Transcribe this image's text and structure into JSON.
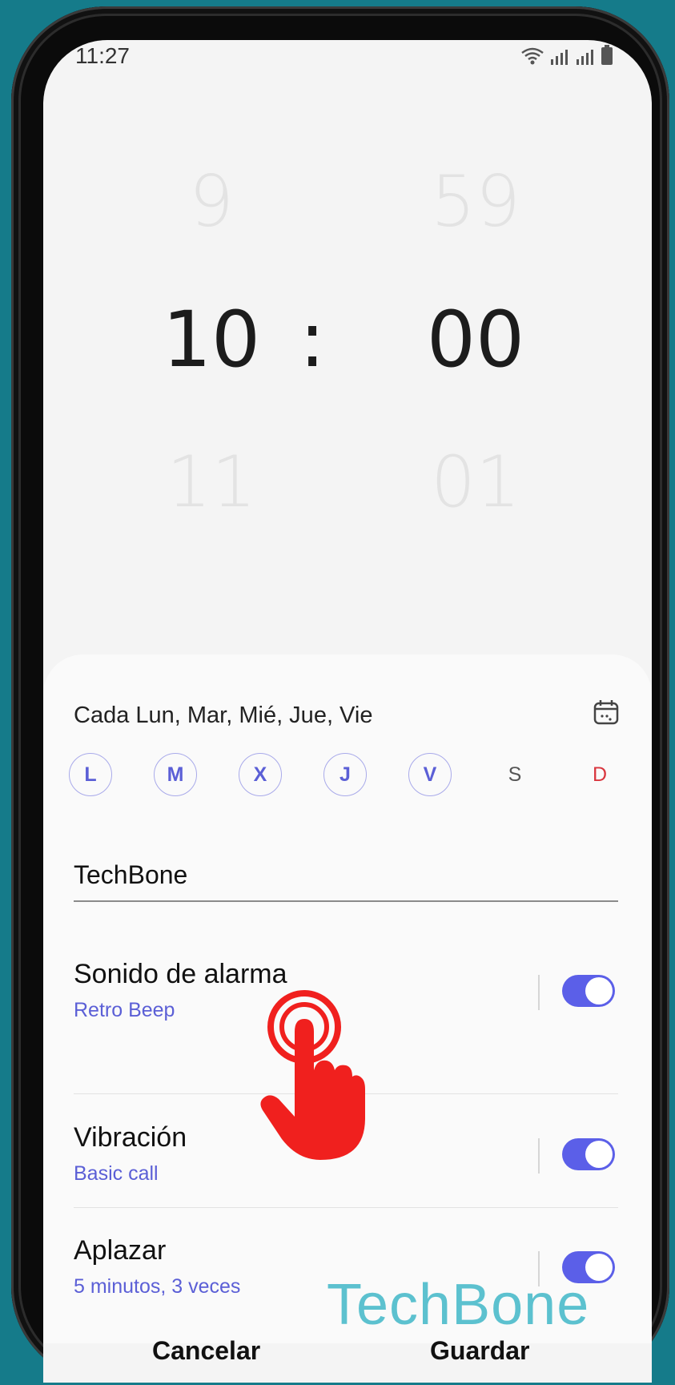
{
  "status": {
    "time": "11:27"
  },
  "picker": {
    "hour_prev": "9",
    "hour": "10",
    "hour_next": "11",
    "separator": ":",
    "minute_prev": "59",
    "minute": "00",
    "minute_next": "01"
  },
  "alarm": {
    "repeat_text": "Cada Lun, Mar, Mié, Jue, Vie",
    "days": [
      {
        "label": "L",
        "active": true
      },
      {
        "label": "M",
        "active": true
      },
      {
        "label": "X",
        "active": true
      },
      {
        "label": "J",
        "active": true
      },
      {
        "label": "V",
        "active": true
      },
      {
        "label": "S",
        "active": false
      },
      {
        "label": "D",
        "active": false
      }
    ],
    "name": "TechBone",
    "settings": [
      {
        "title": "Sonido de alarma",
        "subtitle": "Retro Beep",
        "enabled": true
      },
      {
        "title": "Vibración",
        "subtitle": "Basic call",
        "enabled": true
      },
      {
        "title": "Aplazar",
        "subtitle": "5 minutos, 3 veces",
        "enabled": true
      }
    ]
  },
  "actions": {
    "cancel": "Cancelar",
    "save": "Guardar"
  },
  "watermark": "TechBone",
  "colors": {
    "accent": "#5b5fe8",
    "sunday": "#d9363e",
    "background": "#157b8a",
    "watermark": "#54bfcd",
    "hand": "#f0201e"
  },
  "icons": [
    "wifi-icon",
    "signal-icon",
    "battery-icon",
    "calendar-icon",
    "tap-hand-icon"
  ]
}
